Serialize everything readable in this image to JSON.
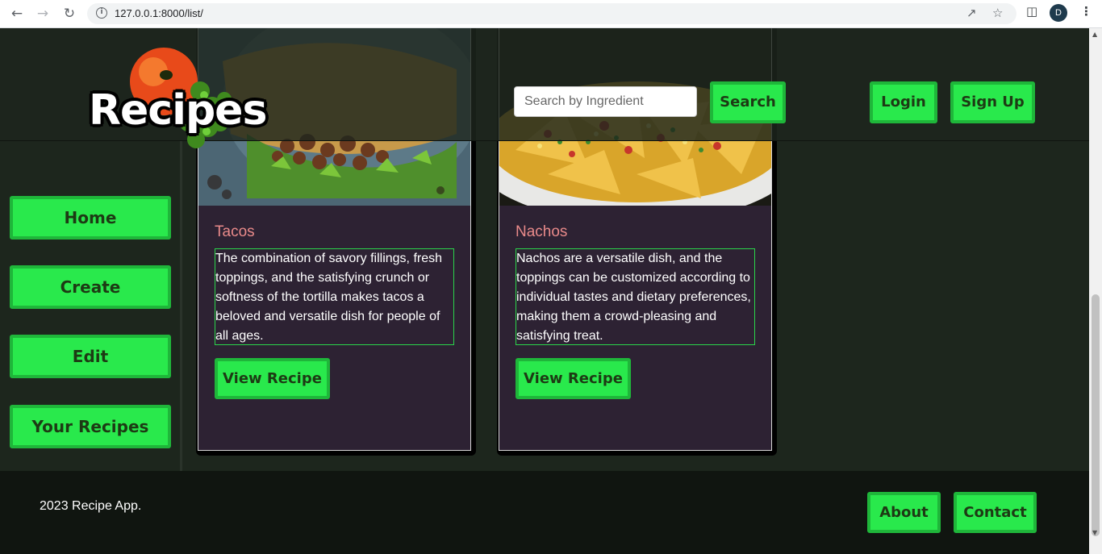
{
  "browser": {
    "url": "127.0.0.1:8000/list/",
    "avatar_initial": "D"
  },
  "header": {
    "logo_text": "Recipes",
    "search_placeholder": "Search by Ingredient",
    "search_label": "Search",
    "login_label": "Login",
    "signup_label": "Sign Up"
  },
  "sidebar": {
    "items": [
      {
        "label": "Home"
      },
      {
        "label": "Create"
      },
      {
        "label": "Edit"
      },
      {
        "label": "Your Recipes"
      }
    ]
  },
  "cards": [
    {
      "title": "Tacos",
      "description": "The combination of savory fillings, fresh toppings, and the satisfying crunch or softness of the tortilla makes tacos a beloved and versatile dish for people of all ages.",
      "button_label": "View Recipe"
    },
    {
      "title": "Nachos",
      "description": "Nachos are a versatile dish, and the toppings can be customized according to individual tastes and dietary preferences, making them a crowd-pleasing and satisfying treat.",
      "button_label": "View Recipe"
    }
  ],
  "footer": {
    "copyright": "2023 Recipe App.",
    "about_label": "About",
    "contact_label": "Contact"
  },
  "colors": {
    "accent_green": "#29e94c",
    "page_bg": "#1d261d",
    "card_bg": "#2d2233",
    "card_title": "#e98a8a"
  }
}
